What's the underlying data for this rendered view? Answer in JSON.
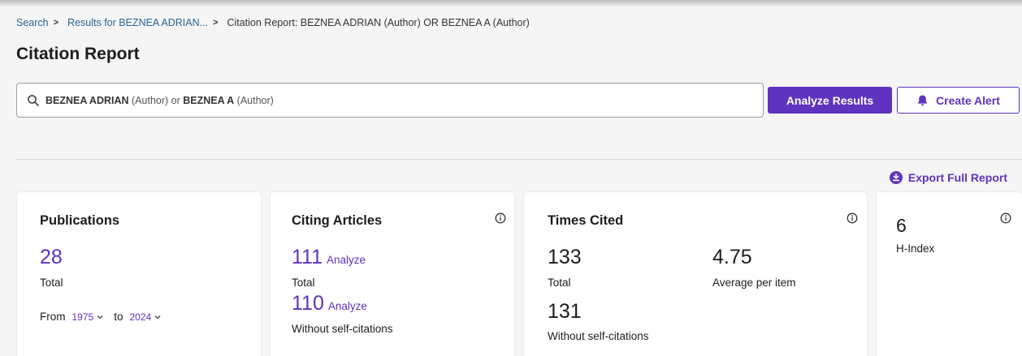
{
  "breadcrumb": {
    "items": [
      {
        "label": "Search"
      },
      {
        "label": "Results for BEZNEA ADRIAN..."
      }
    ],
    "current": "Citation Report: BEZNEA ADRIAN (Author) OR BEZNEA A (Author)"
  },
  "page_title": "Citation Report",
  "search": {
    "term1": "BEZNEA ADRIAN",
    "field1": " (Author) or ",
    "term2": "BEZNEA A",
    "field2": " (Author)"
  },
  "buttons": {
    "analyze_results": "Analyze Results",
    "create_alert": "Create Alert",
    "export_full_report": "Export Full Report"
  },
  "publications": {
    "title": "Publications",
    "total": "28",
    "total_label": "Total",
    "from_label": "From",
    "from_year": "1975",
    "to_label": "to",
    "to_year": "2024"
  },
  "citing_articles": {
    "title": "Citing Articles",
    "total": "111",
    "analyze_label": "Analyze",
    "total_label": "Total",
    "without_self": "110",
    "without_self_label": "Without self-citations"
  },
  "times_cited": {
    "title": "Times Cited",
    "total": "133",
    "total_label": "Total",
    "average": "4.75",
    "average_label": "Average per item",
    "without_self": "131",
    "without_self_label": "Without self-citations"
  },
  "h_index": {
    "value": "6",
    "label": "H-Index"
  },
  "colors": {
    "accent": "#5e33bf",
    "link": "#2a6496",
    "background": "#f5f5f5"
  },
  "icons": [
    "search-icon",
    "bell-icon",
    "download-icon",
    "info-icon",
    "chevron-down-icon"
  ]
}
